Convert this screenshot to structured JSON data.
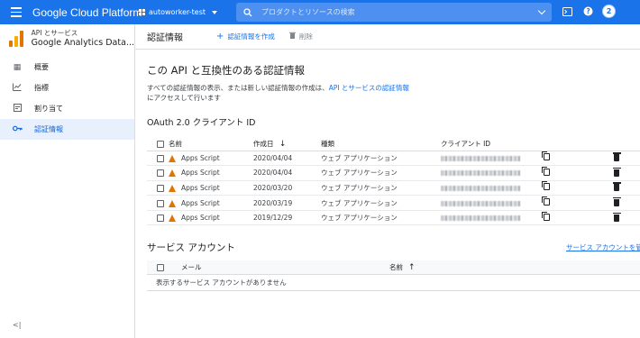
{
  "topbar": {
    "brand": "Google Cloud Platform",
    "project": "autoworker-test",
    "search_placeholder": "プロダクトとリソースの検索",
    "avatar": "2",
    "icons": [
      "menu-icon",
      "project-icon",
      "search-icon",
      "terminal-icon",
      "help-icon",
      "account-avatar"
    ]
  },
  "sidebar": {
    "api_small": "API とサービス",
    "api_big": "Google Analytics Data...",
    "items": [
      {
        "label": "概要",
        "icon": "dashboard-icon"
      },
      {
        "label": "指標",
        "icon": "chart-icon"
      },
      {
        "label": "割り当て",
        "icon": "calendar-icon"
      },
      {
        "label": "認証情報",
        "icon": "key-icon",
        "active": true
      }
    ]
  },
  "header": {
    "title": "認証情報",
    "create_label": "認証情報を作成",
    "delete_label": "削除"
  },
  "section": {
    "title": "この API と互換性のある認証情報",
    "desc_prefix": "すべての認証情報の表示、または新しい認証情報の作成は、",
    "desc_link": "API とサービスの認証情報",
    "desc_suffix": "にアクセスして行います"
  },
  "oauth": {
    "title": "OAuth 2.0 クライアント ID",
    "columns": {
      "name": "名前",
      "created": "作成日",
      "type": "種類",
      "client_id": "クライアント ID"
    },
    "rows": [
      {
        "name": "Apps Script",
        "created": "2020/04/04",
        "type": "ウェブ アプリケーション"
      },
      {
        "name": "Apps Script",
        "created": "2020/04/04",
        "type": "ウェブ アプリケーション"
      },
      {
        "name": "Apps Script",
        "created": "2020/03/20",
        "type": "ウェブ アプリケーション"
      },
      {
        "name": "Apps Script",
        "created": "2020/03/19",
        "type": "ウェブ アプリケーション"
      },
      {
        "name": "Apps Script",
        "created": "2019/12/29",
        "type": "ウェブ アプリケーション"
      }
    ]
  },
  "service_accounts": {
    "title": "サービス アカウント",
    "manage_link": "サービス アカウントを管理",
    "col_email": "メール",
    "col_name": "名前",
    "empty": "表示するサービス アカウントがありません"
  }
}
